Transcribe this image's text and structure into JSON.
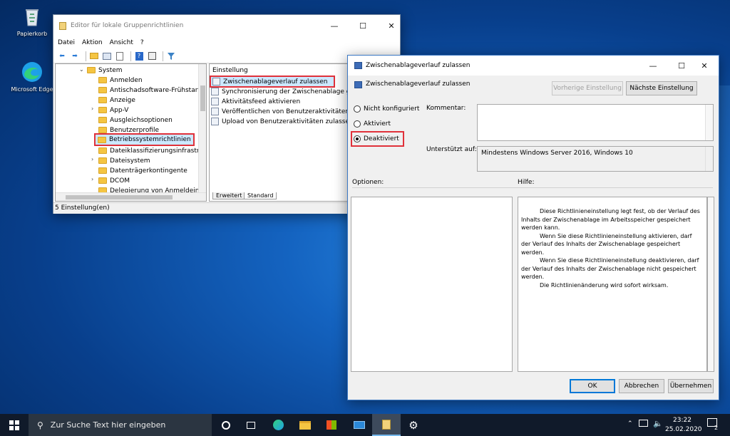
{
  "desktop": {
    "icons": [
      {
        "label": "Papierkorb",
        "icon": "recycle-bin-icon"
      },
      {
        "label": "Microsoft Edge",
        "icon": "edge-icon"
      }
    ]
  },
  "gpedit": {
    "title": "Editor für lokale Gruppenrichtlinien",
    "menu": [
      "Datei",
      "Aktion",
      "Ansicht",
      "?"
    ],
    "tree": [
      {
        "label": "System",
        "expanded": true
      },
      {
        "label": "Anmelden"
      },
      {
        "label": "Antischadsoftware-Frühstart"
      },
      {
        "label": "Anzeige"
      },
      {
        "label": "App-V",
        "collapsed": true
      },
      {
        "label": "Ausgleichsoptionen"
      },
      {
        "label": "Benutzerprofile"
      },
      {
        "label": "Betriebssystemrichtlinien",
        "selected": true
      },
      {
        "label": "Dateiklassifizierungsinfrastrukt"
      },
      {
        "label": "Dateisystem",
        "collapsed": true
      },
      {
        "label": "Datenträgerkontingente"
      },
      {
        "label": "DCOM",
        "collapsed": true
      },
      {
        "label": "Delegierung von Anmeldeinfon"
      }
    ],
    "list_header": "Einstellung",
    "settings": [
      "Zwischenablageverlauf zulassen",
      "Synchronisierung der Zwischenablage geräte",
      "Aktivitätsfeed aktivieren",
      "Veröffentlichen von Benutzeraktivitäten zulass",
      "Upload von Benutzeraktivitäten zulassen"
    ],
    "tabs": [
      "Erweitert",
      "Standard"
    ],
    "status": "5 Einstellung(en)"
  },
  "dialog": {
    "title": "Zwischenablageverlauf zulassen",
    "setting_name": "Zwischenablageverlauf zulassen",
    "prev_button": "Vorherige Einstellung",
    "next_button": "Nächste Einstellung",
    "radio_options": [
      "Nicht konfiguriert",
      "Aktiviert",
      "Deaktiviert"
    ],
    "selected_option": "Deaktiviert",
    "comment_label": "Kommentar:",
    "comment_value": "",
    "supported_label": "Unterstützt auf:",
    "supported_value": "Mindestens Windows Server 2016, Windows 10",
    "options_label": "Optionen:",
    "help_label": "Hilfe:",
    "help_paragraphs": [
      "Diese Richtlinieneinstellung legt fest, ob der Verlauf des Inhalts der Zwischenablage im Arbeitsspeicher gespeichert werden kann.",
      "Wenn Sie diese Richtlinieneinstellung aktivieren, darf der Verlauf des Inhalts der Zwischenablage gespeichert werden.",
      "Wenn Sie diese Richtlinieneinstellung deaktivieren, darf der Verlauf des Inhalts der Zwischenablage nicht gespeichert werden.",
      "Die Richtlinienänderung wird sofort wirksam."
    ],
    "ok_button": "OK",
    "cancel_button": "Abbrechen",
    "apply_button": "Übernehmen"
  },
  "taskbar": {
    "search_placeholder": "Zur Suche Text hier eingeben",
    "time": "23:22",
    "date": "25.02.2020",
    "notification_count": "2"
  },
  "colors": {
    "highlight": "#e0313a",
    "accent": "#0078d7"
  }
}
